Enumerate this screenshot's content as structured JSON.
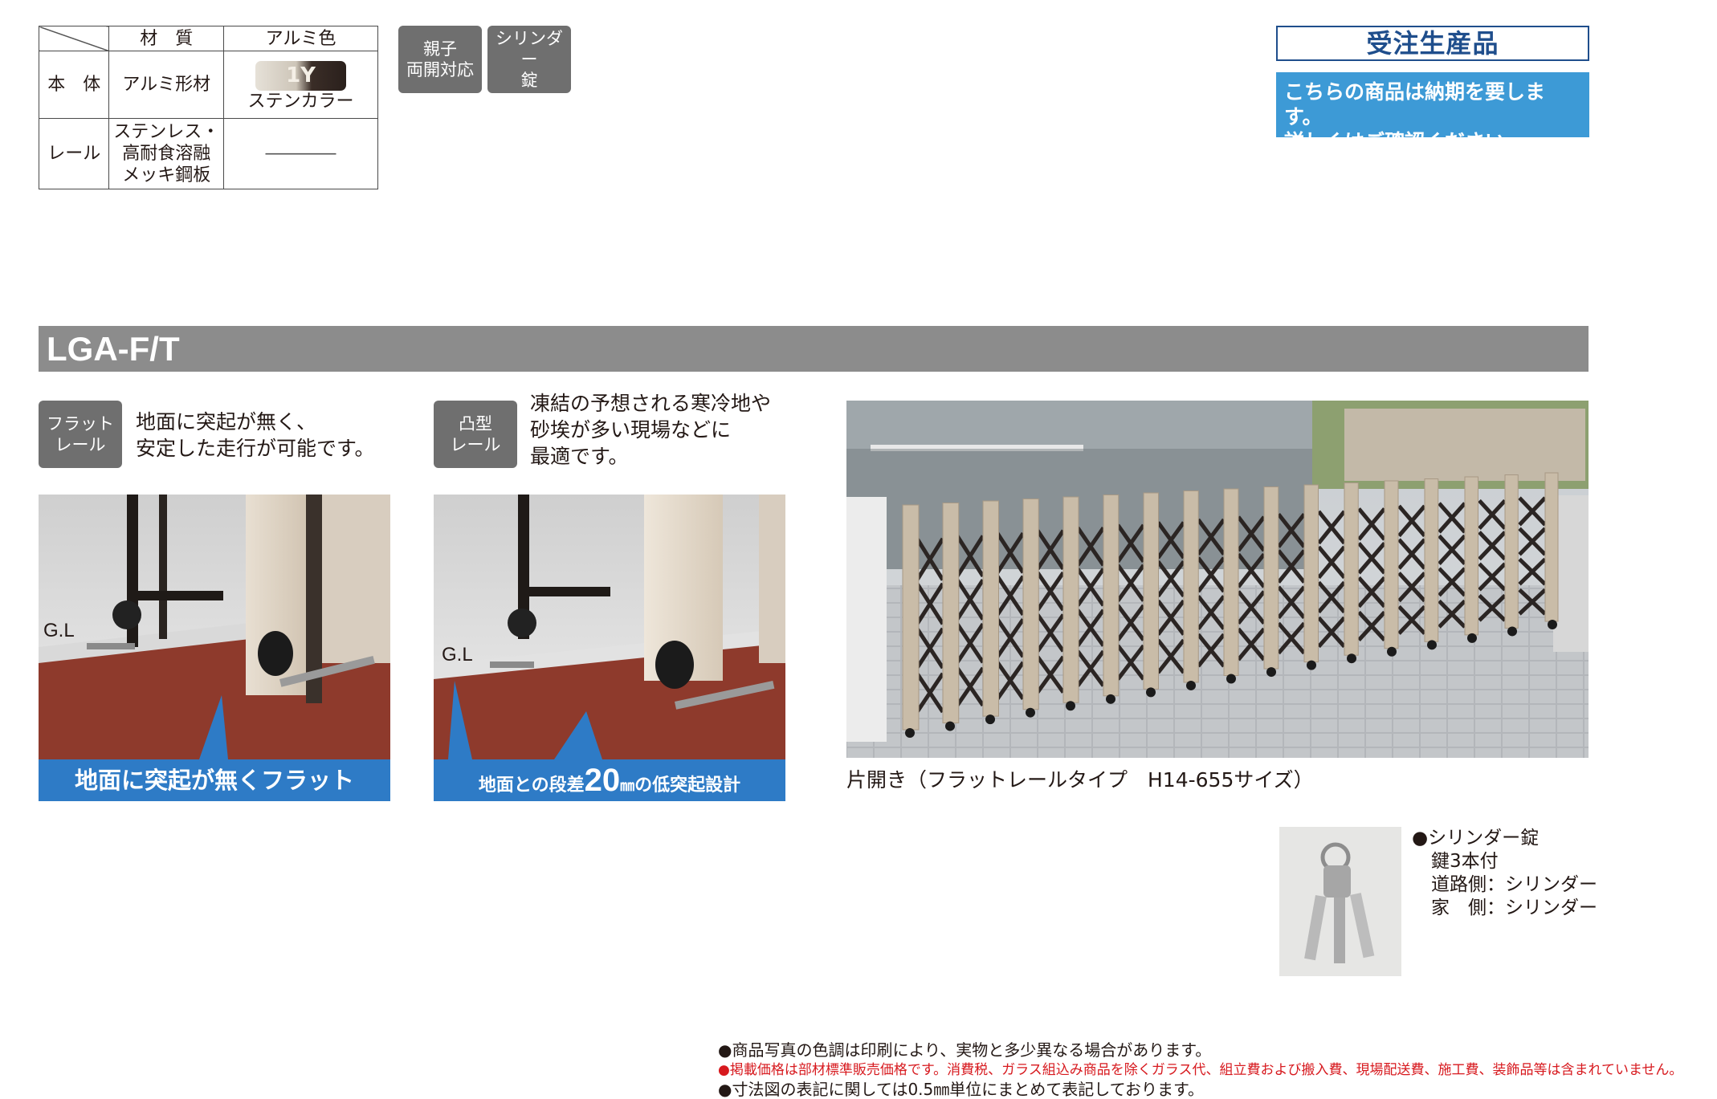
{
  "spec_table": {
    "header": {
      "material": "材　質",
      "color": "アルミ色"
    },
    "rows": [
      {
        "label": "本　体",
        "material": "アルミ形材",
        "swatch_code": "1Y",
        "color_name": "ステンカラー"
      },
      {
        "label": "レール",
        "material_lines": [
          "ステンレス・",
          "高耐食溶融",
          "メッキ鋼板"
        ],
        "color_name": "――――"
      }
    ]
  },
  "tags": {
    "parent_child": [
      "親子",
      "両開対応"
    ],
    "cylinder": [
      "シリンダー",
      "錠"
    ]
  },
  "order": {
    "title": "受注生産品",
    "note_lines": [
      "こちらの商品は納期を要します。",
      "詳しくはご確認ください。"
    ],
    "title_color": "#1f4e8c",
    "note_bg": "#3d9ad6"
  },
  "section": {
    "title": "LGA-F/T"
  },
  "flat_rail": {
    "tag": [
      "フラット",
      "レール"
    ],
    "desc": [
      "地面に突起が無く、",
      "安定した走行が可能です。"
    ],
    "gl": "G.L",
    "banner": "地面に突起が無くフラット"
  },
  "convex_rail": {
    "tag": [
      "凸型",
      "レール"
    ],
    "desc": [
      "凍結の予想される寒冷地や",
      "砂埃が多い現場などに",
      "最適です。"
    ],
    "gl": "G.L",
    "banner_pre": "地面との段差",
    "banner_num": "20",
    "banner_unit": "㎜",
    "banner_post": "の低突起設計"
  },
  "main_photo": {
    "caption": "片開き（フラットレールタイプ　H14-655サイズ）"
  },
  "keys": {
    "lines": [
      "●シリンダー錠",
      "鍵3本付",
      "道路側：シリンダー",
      "家　側：シリンダー"
    ]
  },
  "footnotes": [
    {
      "text": "●商品写真の色調は印刷により、実物と多少異なる場合があります。",
      "color": "#231815"
    },
    {
      "text": "●掲載価格は部材標準販売価格です。消費税、ガラス組込み商品を除くガラス代、組立費および搬入費、現場配送費、施工費、装飾品等は含まれていません。",
      "color": "#d7191e"
    },
    {
      "text": "●寸法図の表記に関しては0.5㎜単位にまとめて表記しております。",
      "color": "#231815"
    }
  ],
  "colors": {
    "section_bar": "#8c8c8c",
    "banner": "#2e7bc6",
    "tag": "#6f6f6f",
    "ground": "#8e3a2c"
  }
}
